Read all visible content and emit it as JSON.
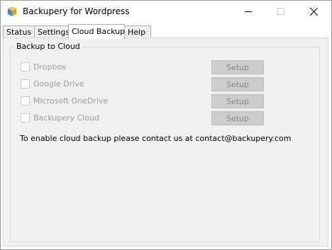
{
  "window": {
    "title": "Backupery for Wordpress"
  },
  "tabs": [
    {
      "label": "Status",
      "active": false
    },
    {
      "label": "Settings",
      "active": false
    },
    {
      "label": "Cloud Backup",
      "active": true
    },
    {
      "label": "Help",
      "active": false
    }
  ],
  "group": {
    "label": "Backup to Cloud",
    "providers": [
      {
        "label": "Dropbox",
        "checked": false,
        "enabled": false,
        "button": "Setup"
      },
      {
        "label": "Google Drive",
        "checked": false,
        "enabled": false,
        "button": "Setup"
      },
      {
        "label": "Microsoft OneDrive",
        "checked": false,
        "enabled": false,
        "button": "Setup"
      },
      {
        "label": "Backupery Cloud",
        "checked": false,
        "enabled": false,
        "button": "Setup"
      }
    ],
    "note": "To enable cloud backup please contact us at contact@backupery.com"
  },
  "icons": {
    "app": "backupery-box-icon",
    "minimize": "minimize-icon",
    "maximize": "maximize-icon",
    "close": "close-icon"
  },
  "colors": {
    "disabled_text": "#a0a0a0",
    "disabled_button": "#cccccc",
    "panel_bg": "#f0f0f0"
  }
}
